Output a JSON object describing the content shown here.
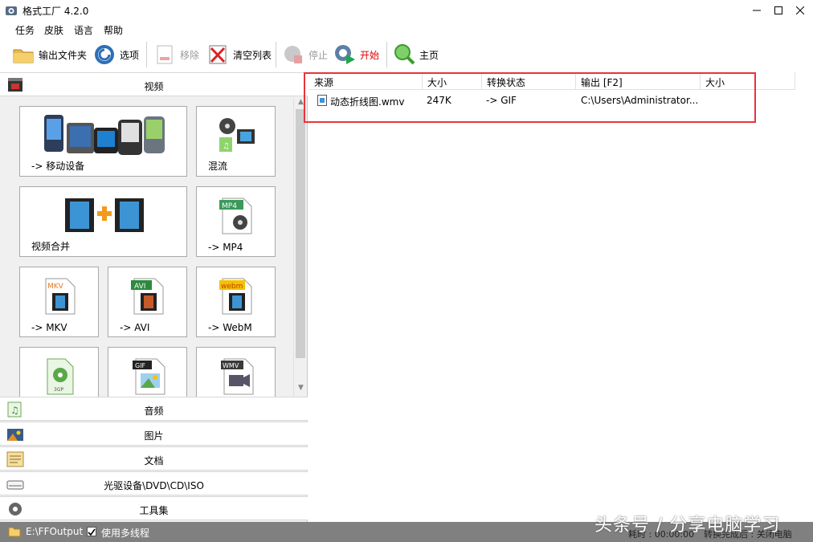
{
  "window": {
    "title": "格式工厂 4.2.0"
  },
  "menu": [
    "任务",
    "皮肤",
    "语言",
    "帮助"
  ],
  "toolbar": {
    "output_folder": "输出文件夹",
    "options": "选项",
    "remove": "移除",
    "clear_list": "清空列表",
    "stop": "停止",
    "start": "开始",
    "home": "主页"
  },
  "categories": {
    "video": "视频",
    "audio": "音频",
    "image": "图片",
    "document": "文档",
    "optical": "光驱设备\\DVD\\CD\\ISO",
    "tools": "工具集"
  },
  "tiles": [
    {
      "label": "-> 移动设备"
    },
    {
      "label": "混流"
    },
    {
      "label": "视频合并"
    },
    {
      "label": "-> MP4",
      "badge": "MP4"
    },
    {
      "label": "-> MKV",
      "badge": "MKV"
    },
    {
      "label": "-> AVI",
      "badge": "AVI"
    },
    {
      "label": "-> WebM",
      "badge": "webm"
    },
    {
      "label": "",
      "badge": "3GP"
    },
    {
      "label": "",
      "badge": "GIF"
    },
    {
      "label": "",
      "badge": "WMV"
    }
  ],
  "list": {
    "columns": [
      "来源",
      "大小",
      "转换状态",
      "输出 [F2]",
      "大小"
    ],
    "rows": [
      {
        "source": "动态折线图.wmv",
        "size": "247K",
        "status": "-> GIF",
        "output": "C:\\Users\\Administrator...",
        "out_size": ""
      }
    ]
  },
  "status": {
    "output_path": "E:\\FFOutput",
    "multithread_label": "使用多线程",
    "multithread_checked": true,
    "elapsed": "耗时 : 00:00:00",
    "after_convert": "转换完成后 : 关闭电脑"
  },
  "watermark": "头条号 / 分享电脑学习",
  "colors": {
    "highlight_border": "#e8343c",
    "statusbar": "#808080",
    "start_label": "#e00000"
  }
}
